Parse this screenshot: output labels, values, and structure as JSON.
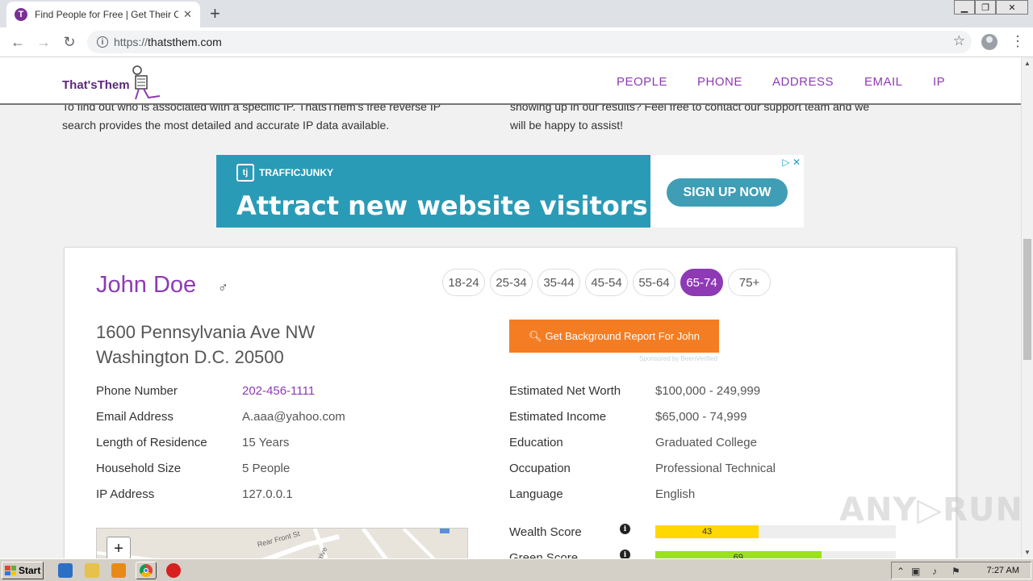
{
  "browser": {
    "tab_title": "Find People for Free | Get Their Cont",
    "tab_favicon_letter": "T",
    "url_scheme": "https://",
    "url_host": "thatsthem.com"
  },
  "site": {
    "logo_text": "That'sThem",
    "nav": [
      "PEOPLE",
      "PHONE",
      "ADDRESS",
      "EMAIL",
      "IP"
    ],
    "intro_left": [
      "To find out who is associated with a specific IP. ThatsThem's free reverse IP",
      "search provides the most detailed and accurate IP data available."
    ],
    "intro_right": [
      "showing up in our results? Feel free to contact our support team and we",
      "will be happy to assist!"
    ]
  },
  "ad": {
    "brand": "TRAFFICJUNKY",
    "brand_mark": "tj",
    "headline": "Attract new website visitors",
    "cta": "SIGN UP NOW"
  },
  "person": {
    "name": "John Doe",
    "gender_symbol": "♂",
    "age_ranges": [
      "18-24",
      "25-34",
      "35-44",
      "45-54",
      "55-64",
      "65-74",
      "75+"
    ],
    "selected_age": "65-74",
    "address_line1": "1600 Pennsylvania Ave NW",
    "address_line2": "Washington D.C. 20500",
    "background_button": "Get Background Report For John",
    "sponsored": "Sponsored by BeenVerified",
    "left_fields": [
      {
        "label": "Phone Number",
        "value": "202-456-1111"
      },
      {
        "label": "Email Address",
        "value": "A.aaa@yahoo.com"
      },
      {
        "label": "Length of Residence",
        "value": "15 Years"
      },
      {
        "label": "Household Size",
        "value": "5 People"
      },
      {
        "label": "IP Address",
        "value": "127.0.0.1"
      }
    ],
    "right_fields": [
      {
        "label": "Estimated Net Worth",
        "value": "$100,000 - 249,999"
      },
      {
        "label": "Estimated Income",
        "value": "$65,000 - 74,999"
      },
      {
        "label": "Education",
        "value": "Graduated College"
      },
      {
        "label": "Occupation",
        "value": "Professional Technical"
      },
      {
        "label": "Language",
        "value": "English"
      }
    ],
    "scores": [
      {
        "label": "Wealth Score",
        "value": "43",
        "fraction": 0.43,
        "color": "#ffd800"
      },
      {
        "label": "Green Score",
        "value": "69",
        "fraction": 0.69,
        "color": "#9be21a"
      }
    ]
  },
  "map": {
    "zoom_in": "+",
    "street_labels": [
      "Rear Front St",
      "Drive"
    ]
  },
  "watermark": "ANY▷RUN",
  "taskbar": {
    "start": "Start",
    "clock": "7:27 AM"
  },
  "colors": {
    "brand_purple": "#8e3ab4",
    "ad_teal": "#2a9bb6",
    "cta_orange": "#f47d23"
  }
}
